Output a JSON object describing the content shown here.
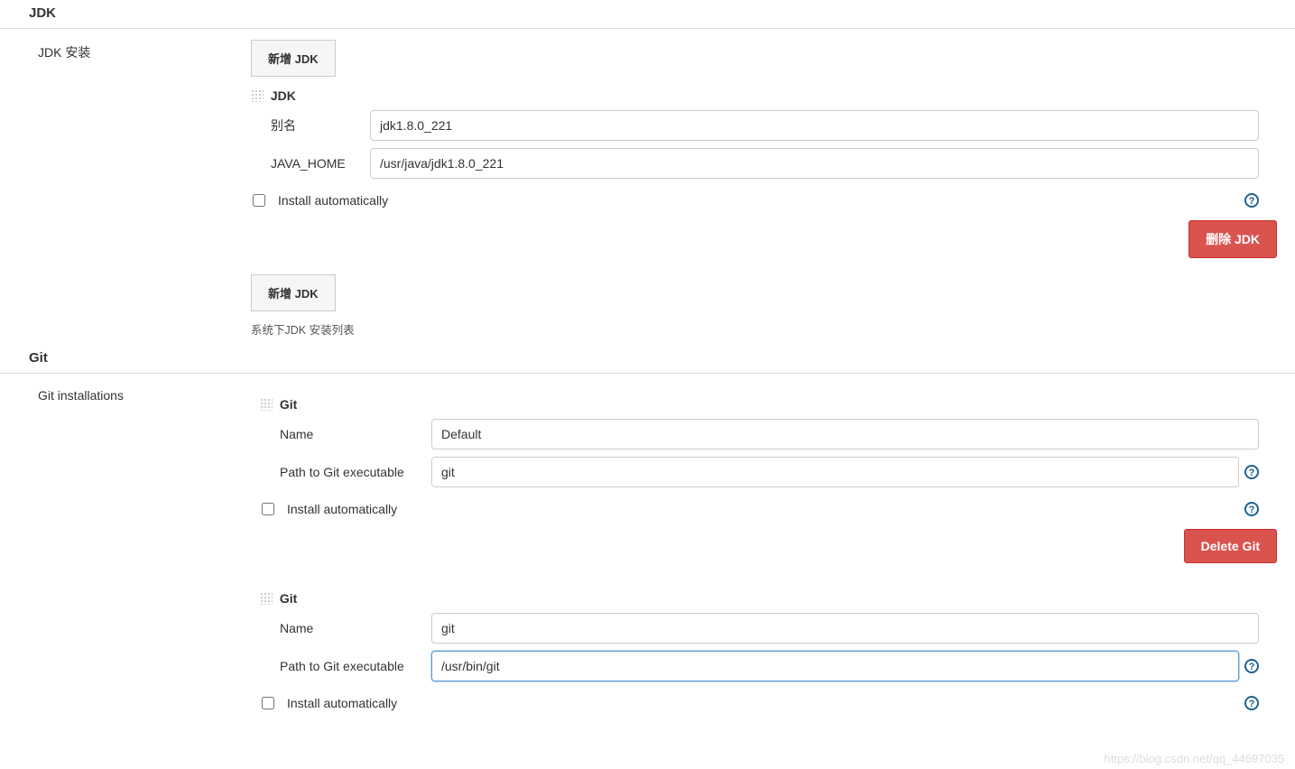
{
  "jdk": {
    "header": "JDK",
    "left_label": "JDK 安装",
    "add_button": "新增 JDK",
    "tool_title": "JDK",
    "alias_label": "别名",
    "alias_value": "jdk1.8.0_221",
    "java_home_label": "JAVA_HOME",
    "java_home_value": "/usr/java/jdk1.8.0_221",
    "install_auto_label": "Install automatically",
    "delete_button": "删除 JDK",
    "add_button2": "新增 JDK",
    "desc": "系统下JDK 安装列表"
  },
  "git": {
    "header": "Git",
    "left_label": "Git installations",
    "tool_title": "Git",
    "name_label": "Name",
    "path_label": "Path to Git executable",
    "install_auto_label": "Install automatically",
    "delete_button": "Delete Git",
    "installs": [
      {
        "name": "Default",
        "path": "git"
      },
      {
        "name": "git",
        "path": "/usr/bin/git"
      }
    ]
  },
  "watermark": "https://blog.csdn.net/qq_44697035"
}
